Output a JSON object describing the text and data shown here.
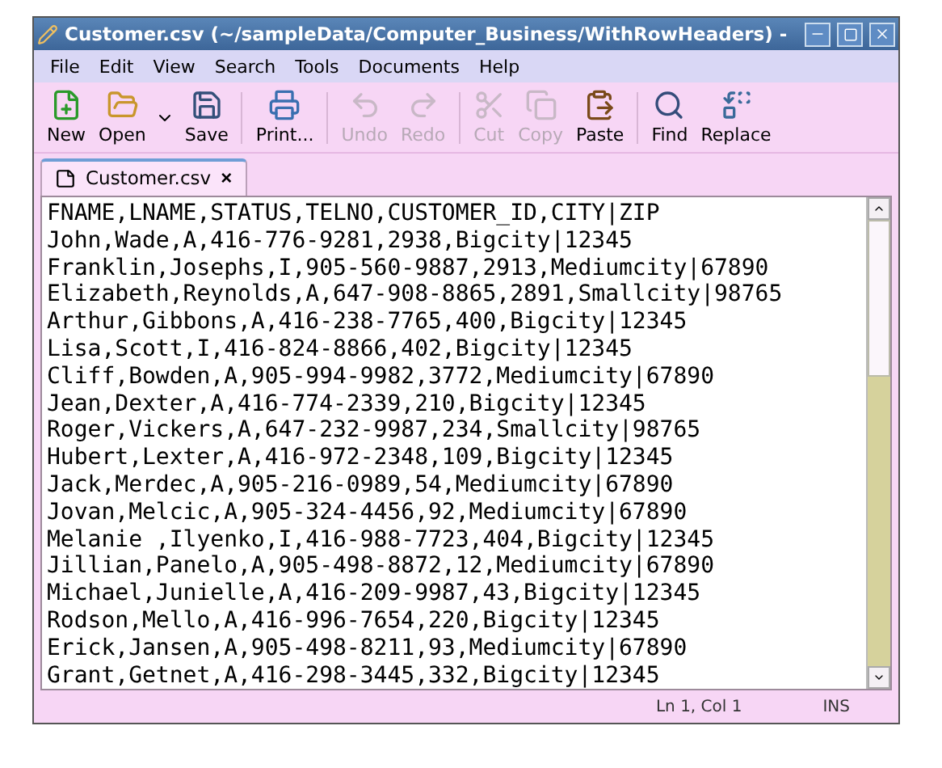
{
  "window": {
    "title": "Customer.csv (~/sampleData/Computer_Business/WithRowHeaders) -"
  },
  "menu": [
    "File",
    "Edit",
    "View",
    "Search",
    "Tools",
    "Documents",
    "Help"
  ],
  "toolbar": [
    {
      "kind": "new",
      "label": "New",
      "disabled": false
    },
    {
      "kind": "open",
      "label": "Open",
      "disabled": false
    },
    {
      "kind": "save",
      "label": "Save",
      "disabled": false
    },
    {
      "kind": "print",
      "label": "Print...",
      "disabled": false
    },
    {
      "kind": "undo",
      "label": "Undo",
      "disabled": true
    },
    {
      "kind": "redo",
      "label": "Redo",
      "disabled": true
    },
    {
      "kind": "cut",
      "label": "Cut",
      "disabled": true
    },
    {
      "kind": "copy",
      "label": "Copy",
      "disabled": true
    },
    {
      "kind": "paste",
      "label": "Paste",
      "disabled": false
    },
    {
      "kind": "find",
      "label": "Find",
      "disabled": false
    },
    {
      "kind": "replace",
      "label": "Replace",
      "disabled": false
    }
  ],
  "tabs": [
    {
      "label": "Customer.csv",
      "selected": true,
      "close": "×"
    }
  ],
  "lines": [
    "FNAME,LNAME,STATUS,TELNO,CUSTOMER_ID,CITY|ZIP",
    "John,Wade,A,416-776-9281,2938,Bigcity|12345",
    "Franklin,Josephs,I,905-560-9887,2913,Mediumcity|67890",
    "Elizabeth,Reynolds,A,647-908-8865,2891,Smallcity|98765",
    "Arthur,Gibbons,A,416-238-7765,400,Bigcity|12345",
    "Lisa,Scott,I,416-824-8866,402,Bigcity|12345",
    "Cliff,Bowden,A,905-994-9982,3772,Mediumcity|67890",
    "Jean,Dexter,A,416-774-2339,210,Bigcity|12345",
    "Roger,Vickers,A,647-232-9987,234,Smallcity|98765",
    "Hubert,Lexter,A,416-972-2348,109,Bigcity|12345",
    "Jack,Merdec,A,905-216-0989,54,Mediumcity|67890",
    "Jovan,Melcic,A,905-324-4456,92,Mediumcity|67890",
    "Melanie ,Ilyenko,I,416-988-7723,404,Bigcity|12345",
    "Jillian,Panelo,A,905-498-8872,12,Mediumcity|67890",
    "Michael,Junielle,A,416-209-9987,43,Bigcity|12345",
    "Rodson,Mello,A,416-996-7654,220,Bigcity|12345",
    "Erick,Jansen,A,905-498-8211,93,Mediumcity|67890",
    "Grant,Getnet,A,416-298-3445,332,Bigcity|12345"
  ],
  "status_bar": {
    "position": "Ln 1, Col 1",
    "mode": "INS"
  }
}
